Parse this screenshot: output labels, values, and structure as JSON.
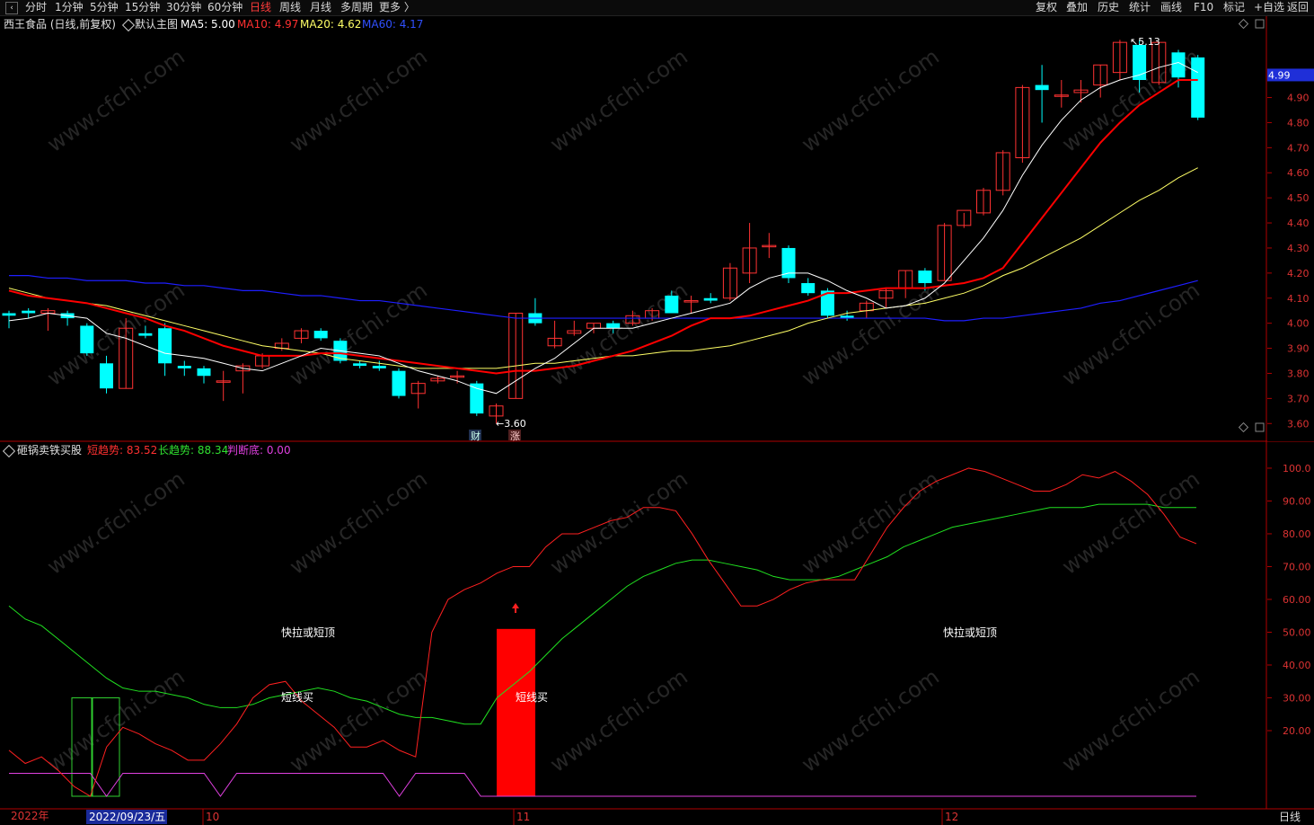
{
  "toolbar": {
    "left": [
      "分时",
      "1分钟",
      "5分钟",
      "15分钟",
      "30分钟",
      "60分钟",
      "日线",
      "周线",
      "月线",
      "多周期",
      "更多 〉"
    ],
    "active": "日线",
    "right": [
      "复权",
      "叠加",
      "历史",
      "统计",
      "画线",
      "F10",
      "标记",
      "+自选",
      "返回"
    ]
  },
  "main_header": {
    "title": "西王食品 (日线,前复权)",
    "template": "默认主图",
    "ma5": "MA5: 5.00",
    "ma10": "MA10: 4.97",
    "ma20": "MA20: 4.62",
    "ma60": "MA60: 4.17"
  },
  "indicator_header": {
    "name": "砸锅卖铁买股",
    "short": "短趋势: 83.52",
    "long": "长趋势: 88.34",
    "bottom": "判断底: 0.00"
  },
  "price_axis": [
    "4.90",
    "4.80",
    "4.70",
    "4.60",
    "4.50",
    "4.40",
    "4.30",
    "4.20",
    "4.10",
    "4.00",
    "3.90",
    "3.80",
    "3.70",
    "3.60"
  ],
  "current_price": "4.99",
  "indicator_axis": [
    "100.0",
    "90.00",
    "80.00",
    "70.00",
    "60.00",
    "50.00",
    "40.00",
    "30.00",
    "20.00"
  ],
  "time_axis": {
    "year": "2022年",
    "cursor": "2022/09/23/五",
    "m10": "10",
    "m11": "11",
    "m12": "12",
    "period": "日线"
  },
  "annotations": {
    "high": "5.13",
    "low": "3.60",
    "cai": "财",
    "zhang": "涨"
  },
  "signals": {
    "top1": "快拉或短顶",
    "top2": "快拉或短顶",
    "buy1": "短线买",
    "buy2": "短线买"
  },
  "watermark": "www.cfchi.com",
  "colors": {
    "up": "#ff3232",
    "down": "#00ffff",
    "ma5": "#ffffff",
    "ma10": "#ff0000",
    "ma20": "#ffff66",
    "ma60": "#1e1eff",
    "short": "#ff2020",
    "long": "#20e020",
    "bottom": "#e040e0"
  },
  "chart_data": {
    "type": "candlestick",
    "price_range": [
      3.54,
      5.16
    ],
    "candles": [
      {
        "o": 4.04,
        "h": 4.05,
        "l": 3.98,
        "c": 4.03
      },
      {
        "o": 4.05,
        "h": 4.06,
        "l": 4.02,
        "c": 4.04
      },
      {
        "o": 4.04,
        "h": 4.06,
        "l": 3.97,
        "c": 4.05
      },
      {
        "o": 4.04,
        "h": 4.05,
        "l": 3.99,
        "c": 4.02
      },
      {
        "o": 3.99,
        "h": 4.0,
        "l": 3.87,
        "c": 3.88
      },
      {
        "o": 3.84,
        "h": 3.87,
        "l": 3.72,
        "c": 3.74
      },
      {
        "o": 3.74,
        "h": 4.02,
        "l": 3.74,
        "c": 3.98
      },
      {
        "o": 3.96,
        "h": 3.99,
        "l": 3.94,
        "c": 3.95
      },
      {
        "o": 3.98,
        "h": 4.0,
        "l": 3.79,
        "c": 3.84
      },
      {
        "o": 3.83,
        "h": 3.85,
        "l": 3.79,
        "c": 3.82
      },
      {
        "o": 3.82,
        "h": 3.83,
        "l": 3.76,
        "c": 3.79
      },
      {
        "o": 3.77,
        "h": 3.81,
        "l": 3.69,
        "c": 3.77
      },
      {
        "o": 3.81,
        "h": 3.84,
        "l": 3.72,
        "c": 3.83
      },
      {
        "o": 3.83,
        "h": 3.88,
        "l": 3.82,
        "c": 3.87
      },
      {
        "o": 3.9,
        "h": 3.94,
        "l": 3.89,
        "c": 3.92
      },
      {
        "o": 3.94,
        "h": 3.98,
        "l": 3.92,
        "c": 3.97
      },
      {
        "o": 3.97,
        "h": 3.98,
        "l": 3.93,
        "c": 3.94
      },
      {
        "o": 3.93,
        "h": 3.94,
        "l": 3.84,
        "c": 3.85
      },
      {
        "o": 3.84,
        "h": 3.85,
        "l": 3.82,
        "c": 3.83
      },
      {
        "o": 3.83,
        "h": 3.85,
        "l": 3.81,
        "c": 3.82
      },
      {
        "o": 3.81,
        "h": 3.82,
        "l": 3.7,
        "c": 3.71
      },
      {
        "o": 3.72,
        "h": 3.77,
        "l": 3.66,
        "c": 3.76
      },
      {
        "o": 3.77,
        "h": 3.79,
        "l": 3.76,
        "c": 3.78
      },
      {
        "o": 3.79,
        "h": 3.81,
        "l": 3.76,
        "c": 3.79
      },
      {
        "o": 3.76,
        "h": 3.77,
        "l": 3.63,
        "c": 3.64
      },
      {
        "o": 3.63,
        "h": 3.68,
        "l": 3.6,
        "c": 3.67
      },
      {
        "o": 3.7,
        "h": 4.04,
        "l": 3.7,
        "c": 4.04
      },
      {
        "o": 4.04,
        "h": 4.1,
        "l": 3.99,
        "c": 4.0
      },
      {
        "o": 3.91,
        "h": 4.01,
        "l": 3.9,
        "c": 3.94
      },
      {
        "o": 3.96,
        "h": 4.01,
        "l": 3.95,
        "c": 3.97
      },
      {
        "o": 3.98,
        "h": 4.0,
        "l": 3.96,
        "c": 4.0
      },
      {
        "o": 4.0,
        "h": 4.01,
        "l": 3.96,
        "c": 3.98
      },
      {
        "o": 4.0,
        "h": 4.05,
        "l": 3.99,
        "c": 4.03
      },
      {
        "o": 4.02,
        "h": 4.06,
        "l": 4.01,
        "c": 4.05
      },
      {
        "o": 4.11,
        "h": 4.13,
        "l": 4.04,
        "c": 4.04
      },
      {
        "o": 4.09,
        "h": 4.11,
        "l": 4.04,
        "c": 4.09
      },
      {
        "o": 4.1,
        "h": 4.12,
        "l": 4.08,
        "c": 4.09
      },
      {
        "o": 4.1,
        "h": 4.24,
        "l": 4.09,
        "c": 4.22
      },
      {
        "o": 4.2,
        "h": 4.4,
        "l": 4.16,
        "c": 4.3
      },
      {
        "o": 4.31,
        "h": 4.36,
        "l": 4.26,
        "c": 4.31
      },
      {
        "o": 4.3,
        "h": 4.31,
        "l": 4.16,
        "c": 4.18
      },
      {
        "o": 4.16,
        "h": 4.18,
        "l": 4.11,
        "c": 4.12
      },
      {
        "o": 4.13,
        "h": 4.14,
        "l": 4.02,
        "c": 4.03
      },
      {
        "o": 4.03,
        "h": 4.05,
        "l": 4.01,
        "c": 4.02
      },
      {
        "o": 4.05,
        "h": 4.09,
        "l": 4.02,
        "c": 4.08
      },
      {
        "o": 4.1,
        "h": 4.14,
        "l": 4.06,
        "c": 4.13
      },
      {
        "o": 4.14,
        "h": 4.21,
        "l": 4.1,
        "c": 4.21
      },
      {
        "o": 4.21,
        "h": 4.22,
        "l": 4.13,
        "c": 4.16
      },
      {
        "o": 4.17,
        "h": 4.4,
        "l": 4.17,
        "c": 4.39
      },
      {
        "o": 4.39,
        "h": 4.44,
        "l": 4.38,
        "c": 4.45
      },
      {
        "o": 4.44,
        "h": 4.54,
        "l": 4.43,
        "c": 4.53
      },
      {
        "o": 4.53,
        "h": 4.69,
        "l": 4.51,
        "c": 4.68
      },
      {
        "o": 4.66,
        "h": 4.95,
        "l": 4.64,
        "c": 4.94
      },
      {
        "o": 4.95,
        "h": 5.03,
        "l": 4.8,
        "c": 4.93
      },
      {
        "o": 4.91,
        "h": 4.97,
        "l": 4.86,
        "c": 4.91
      },
      {
        "o": 4.92,
        "h": 4.97,
        "l": 4.88,
        "c": 4.93
      },
      {
        "o": 4.95,
        "h": 5.03,
        "l": 4.9,
        "c": 5.03
      },
      {
        "o": 5.0,
        "h": 5.13,
        "l": 4.97,
        "c": 5.12
      },
      {
        "o": 5.11,
        "h": 5.13,
        "l": 4.92,
        "c": 4.97
      },
      {
        "o": 4.96,
        "h": 5.12,
        "l": 4.95,
        "c": 5.12
      },
      {
        "o": 5.08,
        "h": 5.09,
        "l": 4.94,
        "c": 4.98
      },
      {
        "o": 5.06,
        "h": 5.07,
        "l": 4.81,
        "c": 4.82
      }
    ],
    "ma5": [
      4.01,
      4.02,
      4.04,
      4.03,
      4.02,
      3.96,
      3.94,
      3.91,
      3.88,
      3.87,
      3.86,
      3.84,
      3.82,
      3.81,
      3.84,
      3.87,
      3.9,
      3.89,
      3.88,
      3.87,
      3.84,
      3.81,
      3.79,
      3.77,
      3.74,
      3.72,
      3.77,
      3.82,
      3.86,
      3.92,
      3.98,
      3.98,
      3.98,
      4.0,
      4.02,
      4.04,
      4.06,
      4.08,
      4.14,
      4.18,
      4.2,
      4.2,
      4.17,
      4.13,
      4.1,
      4.06,
      4.07,
      4.1,
      4.16,
      4.25,
      4.34,
      4.45,
      4.59,
      4.71,
      4.81,
      4.89,
      4.94,
      4.97,
      4.99,
      5.02,
      5.04,
      5.0
    ],
    "ma10": [
      4.13,
      4.11,
      4.1,
      4.09,
      4.08,
      4.06,
      4.04,
      4.02,
      3.99,
      3.97,
      3.94,
      3.91,
      3.89,
      3.87,
      3.87,
      3.87,
      3.88,
      3.88,
      3.87,
      3.86,
      3.85,
      3.84,
      3.83,
      3.82,
      3.81,
      3.8,
      3.81,
      3.81,
      3.82,
      3.83,
      3.85,
      3.87,
      3.89,
      3.92,
      3.95,
      3.99,
      4.02,
      4.02,
      4.03,
      4.05,
      4.07,
      4.09,
      4.12,
      4.12,
      4.13,
      4.14,
      4.14,
      4.14,
      4.15,
      4.16,
      4.18,
      4.22,
      4.32,
      4.42,
      4.52,
      4.62,
      4.72,
      4.8,
      4.87,
      4.92,
      4.97,
      4.97
    ],
    "ma20": [
      4.14,
      4.12,
      4.1,
      4.09,
      4.08,
      4.07,
      4.05,
      4.03,
      4.01,
      3.99,
      3.97,
      3.95,
      3.93,
      3.91,
      3.9,
      3.89,
      3.88,
      3.86,
      3.85,
      3.84,
      3.83,
      3.82,
      3.82,
      3.82,
      3.82,
      3.82,
      3.83,
      3.84,
      3.84,
      3.85,
      3.86,
      3.87,
      3.87,
      3.88,
      3.89,
      3.89,
      3.9,
      3.91,
      3.93,
      3.95,
      3.97,
      4.0,
      4.02,
      4.04,
      4.05,
      4.06,
      4.07,
      4.08,
      4.1,
      4.12,
      4.15,
      4.19,
      4.22,
      4.26,
      4.3,
      4.34,
      4.39,
      4.44,
      4.49,
      4.53,
      4.58,
      4.62
    ],
    "ma60": [
      4.19,
      4.19,
      4.18,
      4.18,
      4.17,
      4.17,
      4.17,
      4.16,
      4.16,
      4.15,
      4.15,
      4.14,
      4.13,
      4.13,
      4.12,
      4.11,
      4.11,
      4.1,
      4.09,
      4.09,
      4.08,
      4.07,
      4.06,
      4.05,
      4.04,
      4.03,
      4.02,
      4.02,
      4.02,
      4.02,
      4.02,
      4.02,
      4.02,
      4.02,
      4.02,
      4.02,
      4.02,
      4.02,
      4.02,
      4.02,
      4.02,
      4.02,
      4.02,
      4.02,
      4.02,
      4.02,
      4.02,
      4.02,
      4.01,
      4.01,
      4.02,
      4.02,
      4.03,
      4.04,
      4.05,
      4.06,
      4.08,
      4.09,
      4.11,
      4.13,
      4.15,
      4.17
    ],
    "indicator": {
      "range": [
        0,
        103
      ],
      "short": [
        14,
        10,
        12,
        8,
        3,
        0,
        15,
        21,
        19,
        16,
        14,
        11,
        11,
        16,
        22,
        30,
        34,
        35,
        29,
        25,
        21,
        15,
        15,
        17,
        14,
        12,
        50,
        60,
        63,
        65,
        68,
        70,
        70,
        76,
        80,
        80,
        82,
        84,
        85,
        88,
        88,
        87,
        80,
        72,
        65,
        58,
        58,
        60,
        63,
        65,
        66,
        66,
        66,
        74,
        82,
        88,
        93,
        96,
        98,
        100,
        99,
        97,
        95,
        93,
        93,
        95,
        98,
        97,
        99,
        96,
        92,
        86,
        79,
        77
      ],
      "long": [
        58,
        54,
        52,
        48,
        44,
        40,
        36,
        33,
        32,
        32,
        31,
        30,
        28,
        27,
        27,
        28,
        30,
        31,
        32,
        33,
        32,
        30,
        29,
        27,
        25,
        24,
        24,
        23,
        22,
        22,
        30,
        34,
        38,
        43,
        48,
        52,
        56,
        60,
        64,
        67,
        69,
        71,
        72,
        72,
        71,
        70,
        69,
        67,
        66,
        66,
        66,
        67,
        69,
        71,
        73,
        76,
        78,
        80,
        82,
        83,
        84,
        85,
        86,
        87,
        88,
        88,
        88,
        89,
        89,
        89,
        89,
        88,
        88,
        88
      ],
      "bottom": [
        7,
        7,
        7,
        7,
        7,
        7,
        0,
        7,
        7,
        7,
        7,
        7,
        7,
        0,
        7,
        7,
        7,
        7,
        7,
        7,
        7,
        7,
        7,
        7,
        0,
        7,
        7,
        7,
        7,
        0,
        0,
        0,
        0,
        0,
        0,
        0,
        0,
        0,
        0,
        0,
        0,
        0,
        0,
        0,
        0,
        0,
        0,
        0,
        0,
        0,
        0,
        0,
        0,
        0,
        0,
        0,
        0,
        0,
        0,
        0,
        0,
        0,
        0,
        0,
        0,
        0,
        0,
        0,
        0,
        0,
        0,
        0,
        0,
        0
      ]
    }
  }
}
